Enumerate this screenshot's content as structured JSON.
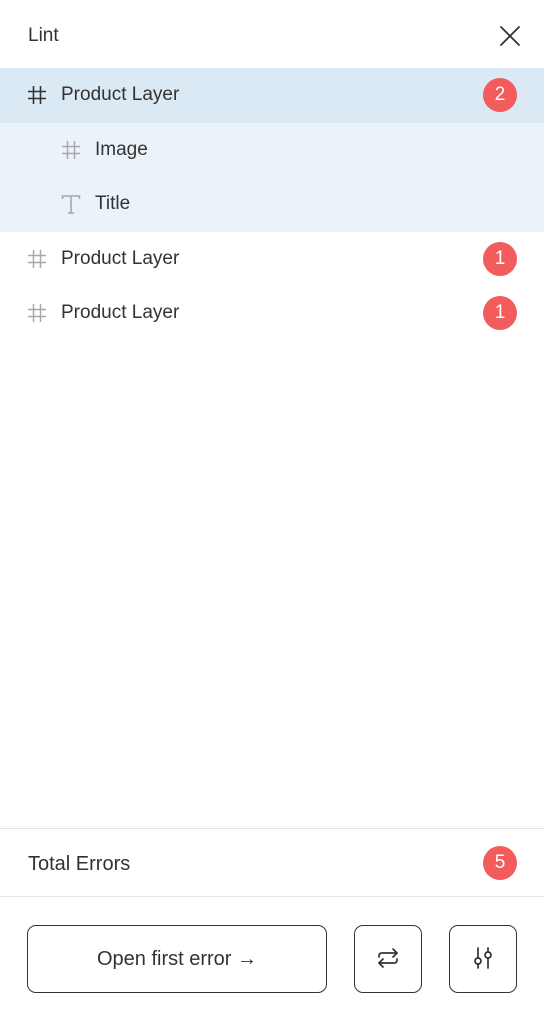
{
  "header": {
    "title": "Lint",
    "close_icon": "close-icon"
  },
  "layers": [
    {
      "label": "Product Layer",
      "icon": "frame-icon",
      "errors": "2",
      "selected": true
    },
    {
      "label": "Image",
      "icon": "frame-icon",
      "child": true
    },
    {
      "label": "Title",
      "icon": "text-icon",
      "child": true
    },
    {
      "label": "Product Layer",
      "icon": "frame-icon",
      "errors": "1"
    },
    {
      "label": "Product Layer",
      "icon": "frame-icon",
      "errors": "1"
    }
  ],
  "totals": {
    "label": "Total Errors",
    "count": "5"
  },
  "footer": {
    "open_first_error_label": "Open first error →",
    "swap_icon": "swap-icon",
    "settings_icon": "settings-sliders-icon"
  },
  "colors": {
    "badge": "#f25c5c",
    "selected_row": "#dbe9f5",
    "child_row": "#ebf3fa"
  }
}
